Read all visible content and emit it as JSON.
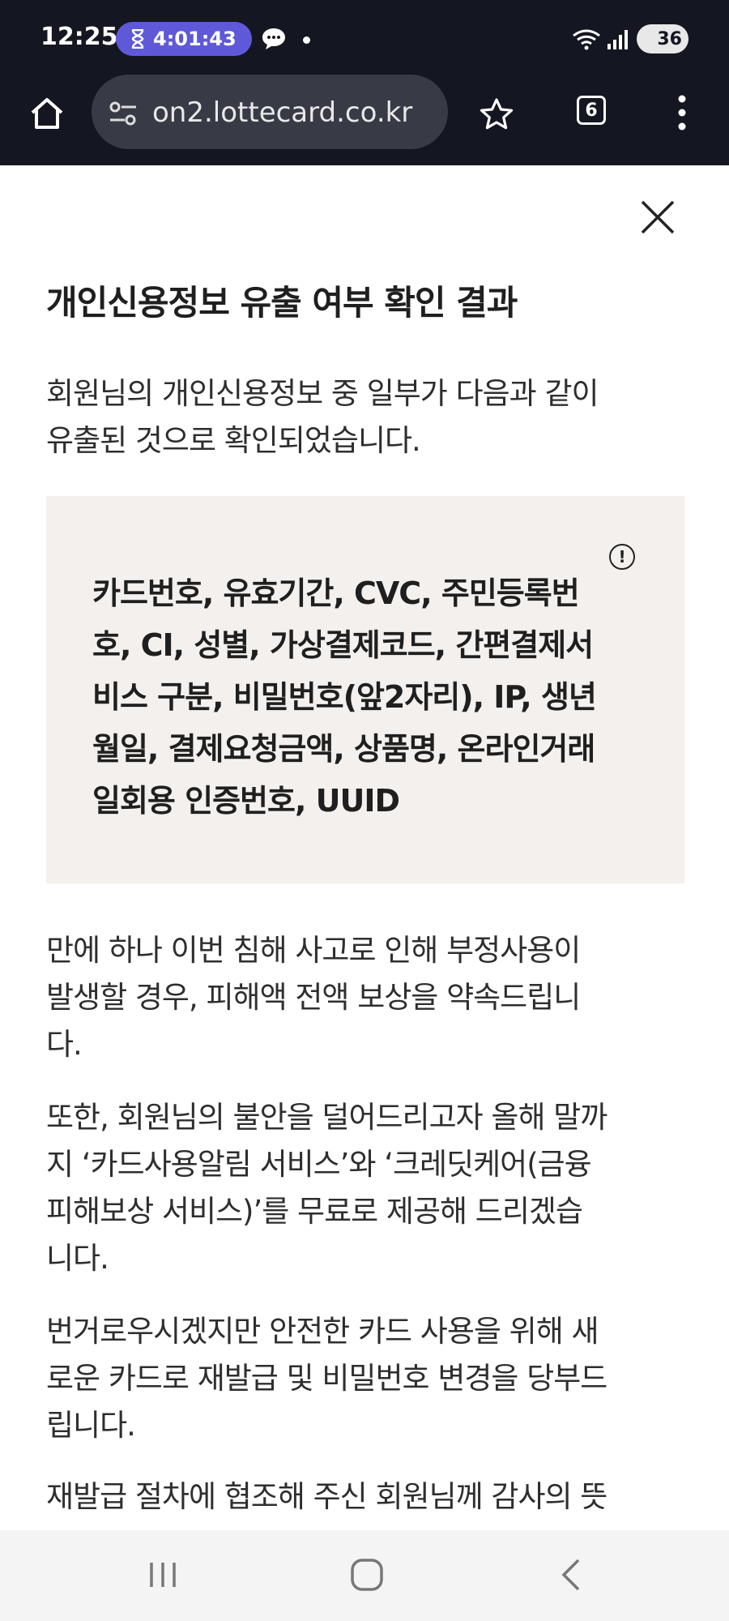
{
  "status_bar": {
    "time": "12:25",
    "timer": "4:01:43",
    "battery": "36",
    "icons": [
      "hourglass-icon",
      "chat-icon",
      "dot-icon",
      "wifi-icon",
      "signal-icon",
      "battery-icon"
    ]
  },
  "browser": {
    "url": "on2.lottecard.co.kr",
    "tab_count": "6",
    "icons": [
      "home-icon",
      "site-settings-icon",
      "bookmark-star-icon",
      "tabs-icon",
      "more-menu-icon"
    ]
  },
  "notice": {
    "title": "개인신용정보 유출 여부 확인 결과",
    "intro_line1": "회원님의 개인신용정보 중 일부가 다음과 같이",
    "intro_line2": "유출된 것으로 확인되었습니다.",
    "leaked_items": [
      "카드번호, 유효기간, CVC, 주민등록번",
      "호, CI, 성별, 가상결제코드, 간편결제서",
      "비스 구분, 비밀번호(앞2자리), IP, 생년",
      "월일, 결제요청금액, 상품명, 온라인거래",
      "일회용 인증번호, UUID"
    ],
    "para1": [
      "만에 하나 이번 침해 사고로 인해 부정사용이",
      "발생할 경우, 피해액 전액 보상을 약속드립니",
      "다."
    ],
    "para2": [
      "또한, 회원님의 불안을 덜어드리고자 올해 말까",
      "지 ‘카드사용알림 서비스’와 ‘크레딧케어(금융",
      "피해보상 서비스)’를 무료로 제공해 드리겠습",
      "니다."
    ],
    "para3": [
      "번거로우시겠지만 안전한 카드 사용을 위해 새",
      "로운 카드로 재발급 및 비밀번호 변경을 당부드",
      "립니다."
    ],
    "para4_partial": "재발급 절차에 협조해 주신 회원님께 감사의 뜻"
  },
  "colors": {
    "status_bg": "#141722",
    "timer_pill": "#5f59d9",
    "box_bg": "#f3f0ee"
  }
}
